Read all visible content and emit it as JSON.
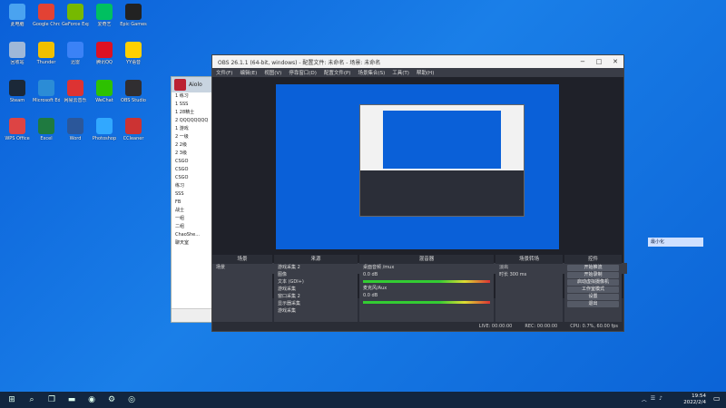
{
  "desktop": {
    "icons": [
      {
        "label": "此电脑",
        "color": "#4aa3f0"
      },
      {
        "label": "Google Chrome",
        "color": "#e34234"
      },
      {
        "label": "GeForce Experience",
        "color": "#76b900"
      },
      {
        "label": "爱奇艺",
        "color": "#00c060"
      },
      {
        "label": "Epic Games",
        "color": "#222222"
      },
      {
        "label": "回收站",
        "color": "#9fb8d8"
      },
      {
        "label": "Thunder",
        "color": "#f0c000"
      },
      {
        "label": "迅雷",
        "color": "#3b82f6"
      },
      {
        "label": "腾讯QQ",
        "color": "#d12"
      },
      {
        "label": "YY语音",
        "color": "#ffd000"
      },
      {
        "label": "Steam",
        "color": "#1b2838"
      },
      {
        "label": "Microsoft Edge",
        "color": "#2b8cd6"
      },
      {
        "label": "网易云音乐",
        "color": "#d33"
      },
      {
        "label": "WeChat",
        "color": "#2dc100"
      },
      {
        "label": "OBS Studio",
        "color": "#302e31"
      },
      {
        "label": "WPS Office",
        "color": "#d44"
      },
      {
        "label": "Excel",
        "color": "#1f7a40"
      },
      {
        "label": "Word",
        "color": "#2b579a"
      },
      {
        "label": "Photoshop",
        "color": "#31a8ff"
      },
      {
        "label": "CCleaner",
        "color": "#c33"
      }
    ]
  },
  "chat_window": {
    "title": "Aiolo",
    "rows": [
      "1 练习",
      "1 SSS",
      "1 28精士",
      "2 QQQQQQQQ",
      "1 游戏",
      "2 一级",
      "2 2级",
      "2 3级",
      "CSGO",
      "CSGO",
      "CSGO",
      "练习",
      "SSS",
      "FB",
      "战士",
      "一组",
      "二组",
      "ChaoShe...",
      "聊天室"
    ]
  },
  "obs": {
    "title": "OBS 26.1.1 (64-bit, windows) - 配置文件: 未命名 - 场景: 未命名",
    "menu": [
      "文件(F)",
      "编辑(E)",
      "视图(V)",
      "停靠窗口(D)",
      "配置文件(P)",
      "场景集合(S)",
      "工具(T)",
      "帮助(H)"
    ],
    "sources_bar": [
      "未选择源",
      "属性",
      "滤镜"
    ],
    "docks": {
      "scenes": {
        "header": "场景",
        "items": [
          "场景"
        ]
      },
      "sources": {
        "header": "来源",
        "items": [
          "游戏采集 2",
          "图像",
          "文本 (GDI+)",
          "游戏采集",
          "窗口采集 2",
          "显示器采集",
          "游戏采集"
        ]
      },
      "mixer": {
        "header": "混音器",
        "items": [
          "桌面音频 /mux",
          "0.0 dB",
          "麦克风/Aux",
          "0.0 dB"
        ]
      },
      "transitions": {
        "header": "场景转场",
        "items": [
          "淡出",
          "时长 300 ms"
        ]
      },
      "controls": {
        "header": "控件",
        "items": [
          "开始推流",
          "开始录制",
          "启动虚拟摄像机",
          "工作室模式",
          "设置",
          "退出"
        ]
      }
    },
    "status": {
      "live": "LIVE: 00:00:00",
      "rec": "REC: 00:00:00",
      "cpu": "CPU: 0.7%, 60.00 fps"
    }
  },
  "tooltip": "最小化",
  "taskbar": {
    "time": "19:54",
    "date": "2022/2/4",
    "apps": [
      "start",
      "search",
      "task-view",
      "explorer",
      "chrome",
      "steam",
      "obs"
    ]
  }
}
